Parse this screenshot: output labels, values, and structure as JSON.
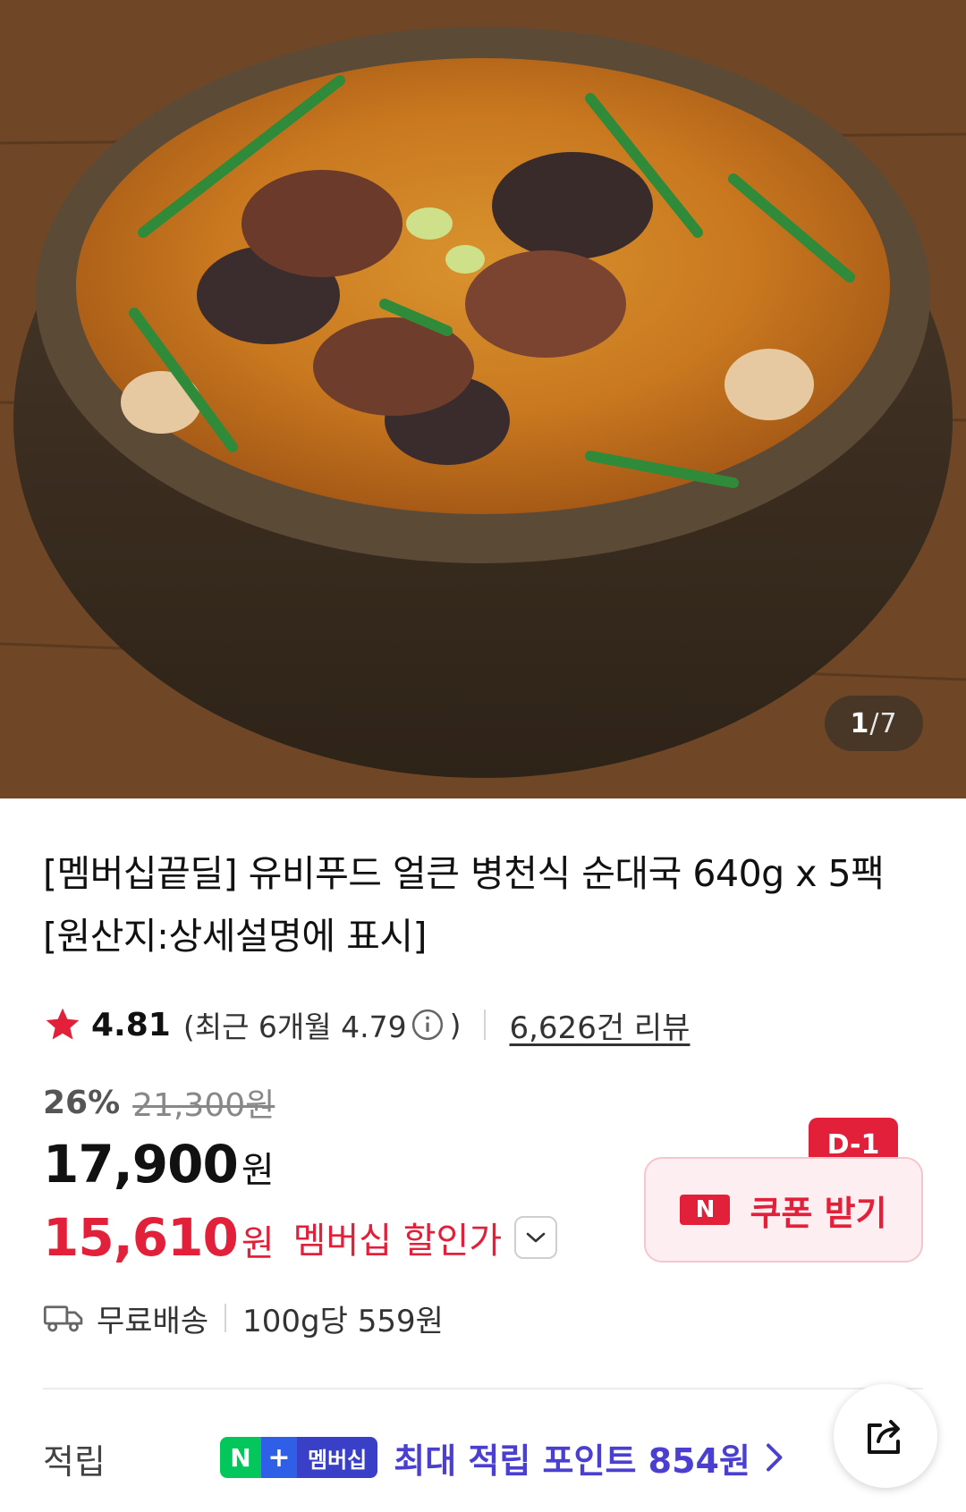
{
  "gallery": {
    "current": "1",
    "separator": "/",
    "total": "7"
  },
  "product": {
    "title": "[멤버십끝딜] 유비푸드 얼큰 병천식 순대국 640g x 5팩 [원산지:상세설명에 표시]"
  },
  "rating": {
    "score": "4.81",
    "recent_prefix": "(최근 6개월 4.79",
    "recent_suffix": ")",
    "review_count": "6,626건 리뷰"
  },
  "price": {
    "discount_rate": "26%",
    "original": "21,300원",
    "sale_amount": "17,900",
    "sale_unit": "원",
    "member_amount": "15,610",
    "member_unit": "원",
    "member_label": "멤버십 할인가"
  },
  "coupon": {
    "badge": "D-1",
    "logo": "N",
    "label": "쿠폰 받기"
  },
  "delivery": {
    "shipping": "무료배송",
    "unit_price": "100g당 559원"
  },
  "points": {
    "label": "적립",
    "badge_n": "N",
    "badge_plus": "+",
    "badge_text": "멤버십",
    "text": "최대 적립 포인트 854원"
  },
  "colors": {
    "accent_red": "#e3203a",
    "points_purple": "#4b3fd1",
    "naver_green": "#03c75a"
  },
  "icons": [
    "star-icon",
    "info-icon",
    "chevron-down-icon",
    "truck-icon",
    "chevron-right-icon",
    "share-icon"
  ]
}
